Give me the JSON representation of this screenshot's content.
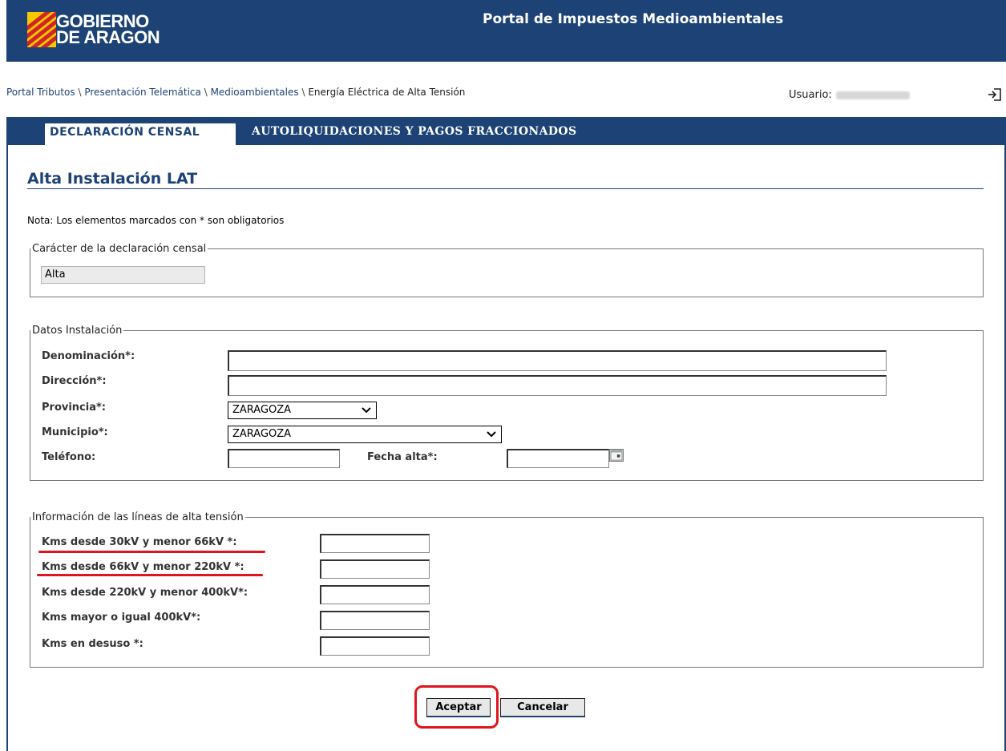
{
  "header": {
    "logo_text_line1": "GOBIERNO",
    "logo_text_line2": "DE ARAGON",
    "title": "Portal de Impuestos Medioambientales"
  },
  "breadcrumb": {
    "items": [
      "Portal Tributos",
      "Presentación Telemática",
      "Medioambientales",
      "Energía Eléctrica de Alta Tensión"
    ],
    "separator": "\\"
  },
  "user": {
    "label": "Usuario:"
  },
  "tabs": [
    {
      "label": "DECLARACIÓN CENSAL",
      "active": true
    },
    {
      "label": "AUTOLIQUIDACIONES Y PAGOS FRACCIONADOS",
      "active": false
    }
  ],
  "page_title": "Alta Instalación LAT",
  "note": "Nota: Los elementos marcados con * son obligatorios",
  "caracter": {
    "legend": "Carácter de la declaración censal",
    "value": "Alta"
  },
  "datos": {
    "legend": "Datos Instalación",
    "denominacion_label": "Denominación*:",
    "direccion_label": "Dirección*:",
    "provincia_label": "Provincia*:",
    "provincia_value": "ZARAGOZA",
    "municipio_label": "Municipio*:",
    "municipio_value": "ZARAGOZA",
    "telefono_label": "Teléfono:",
    "fecha_label": "Fecha alta*:"
  },
  "lineas": {
    "legend": "Información de las líneas de alta tensión",
    "fields": [
      "Kms desde 30kV y menor 66kV *:",
      "Kms desde 66kV y menor 220kV *:",
      "Kms desde 220kV y menor 400kV*:",
      "Kms mayor o igual 400kV*:",
      "Kms en desuso *:"
    ]
  },
  "buttons": {
    "accept": "Aceptar",
    "cancel": "Cancelar"
  },
  "colors": {
    "brand_blue": "#1d4276",
    "highlight_red": "#e0141e"
  }
}
